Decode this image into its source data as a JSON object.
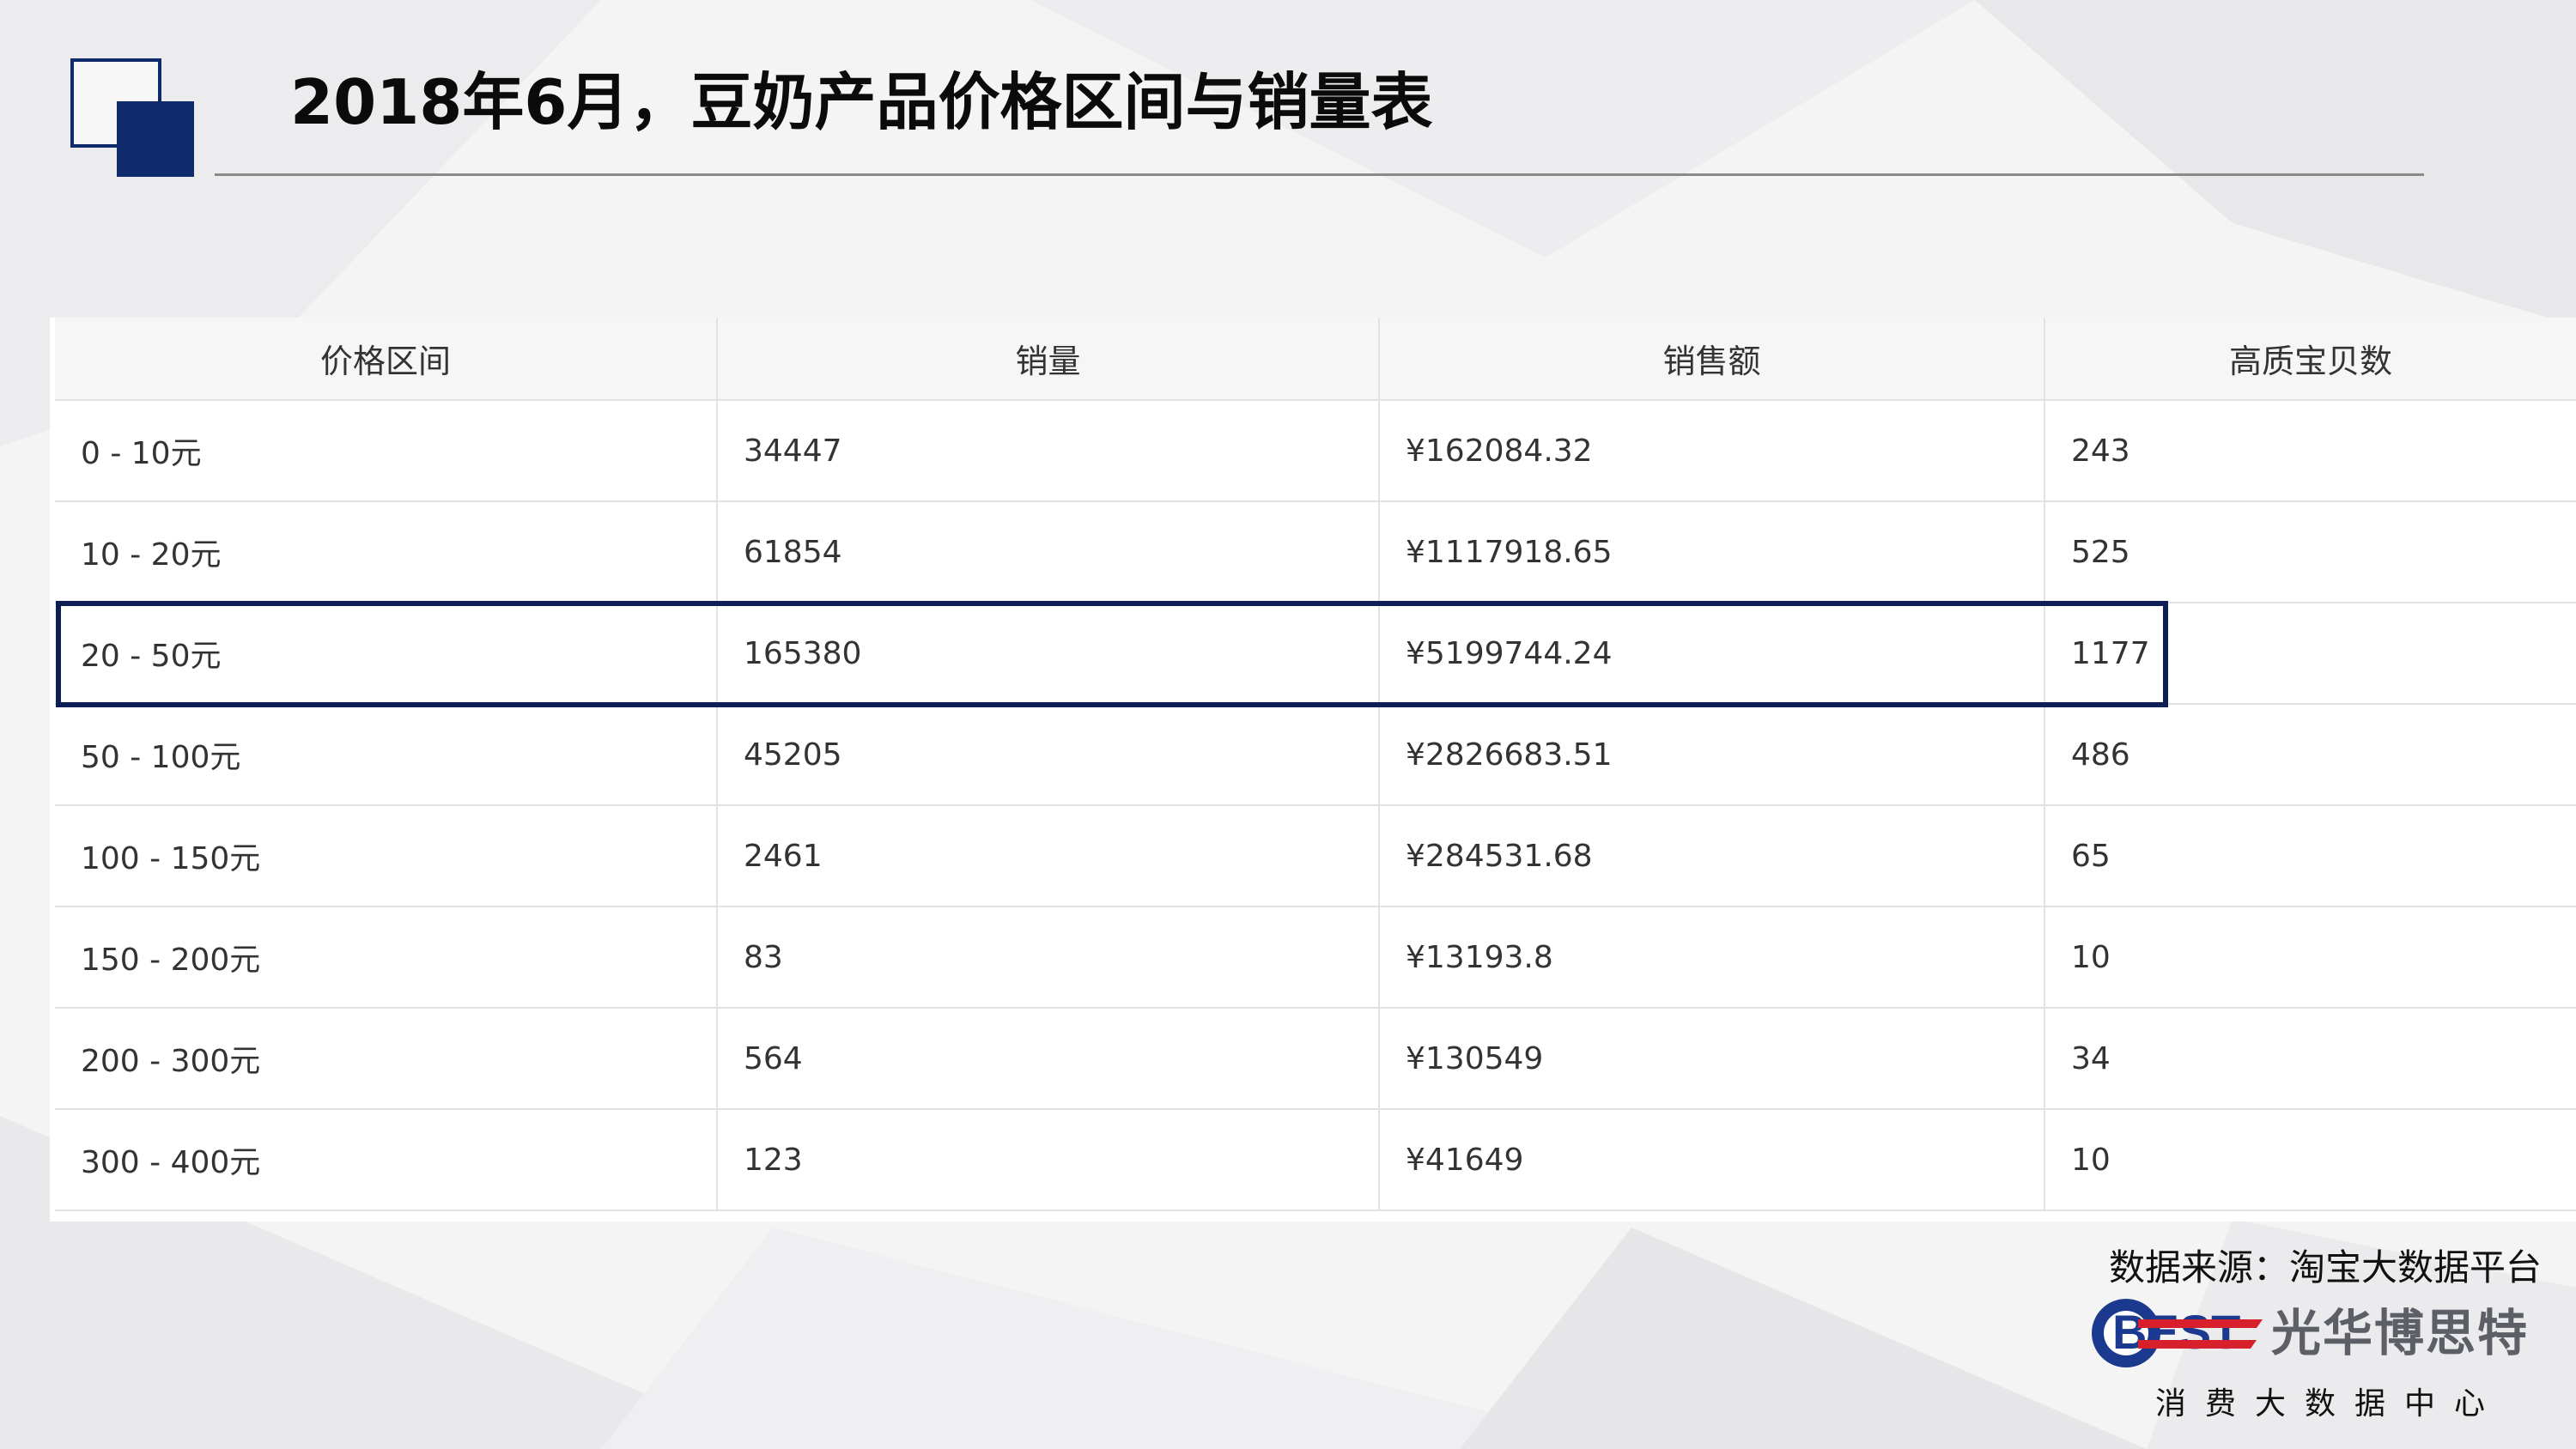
{
  "title": "2018年6月，豆奶产品价格区间与销量表",
  "table": {
    "headers": [
      "价格区间",
      "销量",
      "销售额",
      "高质宝贝数"
    ],
    "rows": [
      {
        "range": "0 - 10元",
        "volume": "34447",
        "revenue": "¥162084.32",
        "items": "243"
      },
      {
        "range": "10 - 20元",
        "volume": "61854",
        "revenue": "¥1117918.65",
        "items": "525"
      },
      {
        "range": "20 - 50元",
        "volume": "165380",
        "revenue": "¥5199744.24",
        "items": "1177"
      },
      {
        "range": "50 - 100元",
        "volume": "45205",
        "revenue": "¥2826683.51",
        "items": "486"
      },
      {
        "range": "100 - 150元",
        "volume": "2461",
        "revenue": "¥284531.68",
        "items": "65"
      },
      {
        "range": "150 - 200元",
        "volume": "83",
        "revenue": "¥13193.8",
        "items": "10"
      },
      {
        "range": "200 - 300元",
        "volume": "564",
        "revenue": "¥130549",
        "items": "34"
      },
      {
        "range": "300 - 400元",
        "volume": "123",
        "revenue": "¥41649",
        "items": "10"
      }
    ],
    "highlighted_row": "20 - 50元"
  },
  "source": "数据来源：淘宝大数据平台",
  "logo": {
    "mark_text": "BEST",
    "name": "光华博思特",
    "subtitle": "消费大数据中心"
  },
  "colors": {
    "accent_navy": "#0f2b6b",
    "highlight_border": "#0e1f55",
    "logo_blue": "#1b3a8f",
    "logo_red": "#d7202c"
  }
}
